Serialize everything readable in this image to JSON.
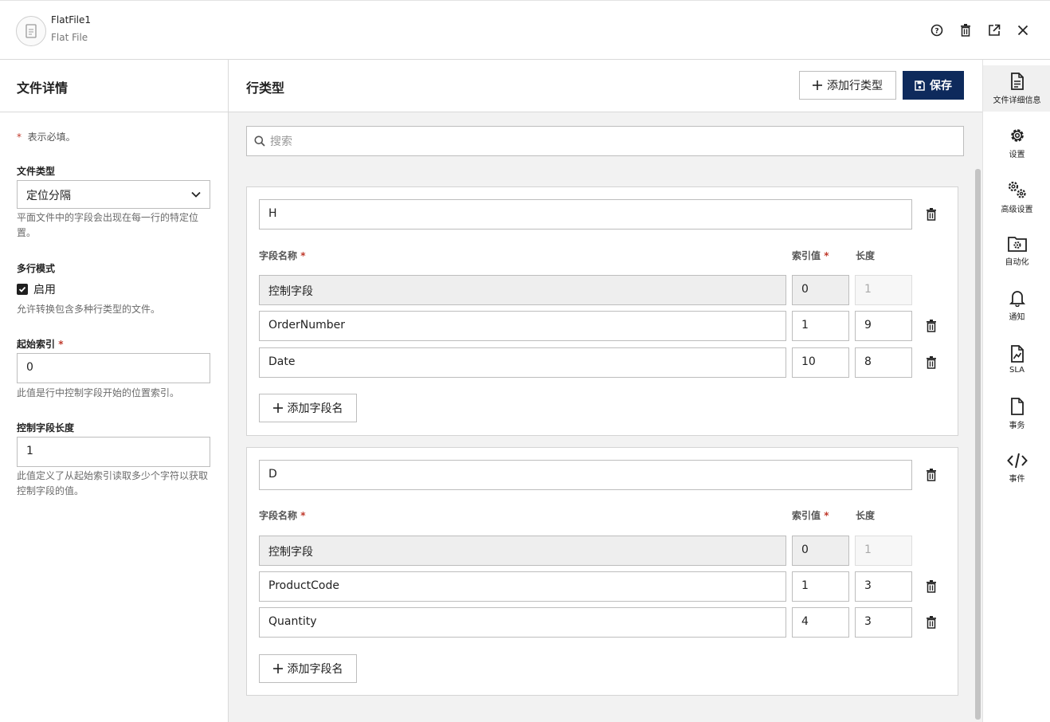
{
  "header": {
    "title": "FlatFile1",
    "subtitle": "Flat File",
    "icons": [
      "help-icon",
      "trash-icon",
      "external-link-icon",
      "close-icon"
    ]
  },
  "left": {
    "heading": "文件详情",
    "required_note_star": "*",
    "required_note": "表示必填。",
    "file_type": {
      "label": "文件类型",
      "value": "定位分隔",
      "help": "平面文件中的字段会出现在每一行的特定位置。"
    },
    "multiline": {
      "label": "多行模式",
      "checkbox_label": "启用",
      "checked": true,
      "help": "允许转换包含多种行类型的文件。"
    },
    "start_index": {
      "label": "起始索引",
      "required": "*",
      "value": "0",
      "help": "此值是行中控制字段开始的位置索引。"
    },
    "control_length": {
      "label": "控制字段长度",
      "value": "1",
      "help": "此值定义了从起始索引读取多少个字符以获取控制字段的值。"
    }
  },
  "main": {
    "title": "行类型",
    "add_row_type_label": "添加行类型",
    "save_label": "保存",
    "search_placeholder": "搜索",
    "col_name": "字段名称",
    "col_index": "索引值",
    "col_length": "长度",
    "required": "*",
    "add_field_label": "添加字段名",
    "row_types": [
      {
        "name": "H",
        "fields": [
          {
            "name": "控制字段",
            "index": "0",
            "length": "1"
          },
          {
            "name": "OrderNumber",
            "index": "1",
            "length": "9"
          },
          {
            "name": "Date",
            "index": "10",
            "length": "8"
          }
        ]
      },
      {
        "name": "D",
        "fields": [
          {
            "name": "控制字段",
            "index": "0",
            "length": "1"
          },
          {
            "name": "ProductCode",
            "index": "1",
            "length": "3"
          },
          {
            "name": "Quantity",
            "index": "4",
            "length": "3"
          }
        ]
      }
    ]
  },
  "rail": {
    "items": [
      {
        "label": "文件详细信息",
        "icon": "document-icon",
        "active": true
      },
      {
        "label": "设置",
        "icon": "gear-icon"
      },
      {
        "label": "高级设置",
        "icon": "gears-icon"
      },
      {
        "label": "自动化",
        "icon": "folder-gear-icon"
      },
      {
        "label": "通知",
        "icon": "bell-icon"
      },
      {
        "label": "SLA",
        "icon": "sla-chart-icon"
      },
      {
        "label": "事务",
        "icon": "file-icon"
      },
      {
        "label": "事件",
        "icon": "code-icon"
      }
    ]
  },
  "colors": {
    "primary": "#0e2a5c",
    "required": "#c0392b"
  }
}
